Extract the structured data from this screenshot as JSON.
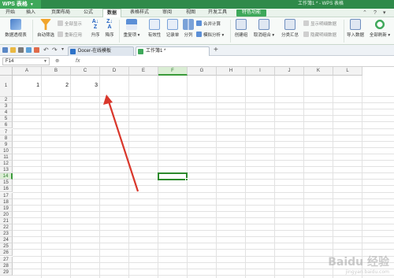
{
  "app": {
    "name": "WPS 表格",
    "title": "工作簿1 * - WPS 表格"
  },
  "menu_tabs": [
    "开始",
    "插入",
    "页面布局",
    "公式",
    "数据",
    "表格样式",
    "审阅",
    "视图",
    "开发工具",
    "特色功能"
  ],
  "active_menu_tab": "数据",
  "ribbon": {
    "pivot": "数据透视表",
    "autofilter": "自动筛选",
    "show_all": "全部显示",
    "reapply": "重新应用",
    "sort_asc": "升序",
    "sort_desc": "降序",
    "duplicates": "重复项",
    "validity": "有效性",
    "record": "记录单",
    "split": "分列",
    "consolidate": "合并计算",
    "what_if": "模拟分析",
    "create_group": "创建组",
    "ungroup": "取消组合",
    "subtotal": "分类汇总",
    "show_detail": "显示明细数据",
    "hide_detail": "隐藏明细数据",
    "import_data": "导入数据",
    "refresh_all": "全部刷新"
  },
  "doc_tabs": [
    {
      "label": "Docer-在线模板"
    },
    {
      "label": "工作簿1 *"
    }
  ],
  "formula_bar": {
    "name_box": "F14",
    "fx": "fx",
    "formula": ""
  },
  "columns": [
    "A",
    "B",
    "C",
    "D",
    "E",
    "F",
    "G",
    "H",
    "I",
    "J",
    "K",
    "L"
  ],
  "selected_column": "F",
  "rows": [
    "1",
    "2",
    "3",
    "4",
    "5",
    "6",
    "7",
    "8",
    "9",
    "10",
    "11",
    "12",
    "13",
    "14",
    "15",
    "16",
    "17",
    "18",
    "19",
    "20",
    "21",
    "22",
    "23",
    "24",
    "25",
    "26",
    "27",
    "28",
    "29"
  ],
  "selected_row": "14",
  "cells": [
    {
      "ref": "A1",
      "value": "1"
    },
    {
      "ref": "B1",
      "value": "2"
    },
    {
      "ref": "C1",
      "value": "3"
    }
  ],
  "annotation": {
    "color": "#d9372b"
  },
  "watermark": {
    "text": "Baidu 经验",
    "sub": "jingyan.baidu.com"
  },
  "colors": {
    "title_bar": "#2f8a4a",
    "accent": "#3ea85a",
    "selection": "#2d8a2d"
  }
}
